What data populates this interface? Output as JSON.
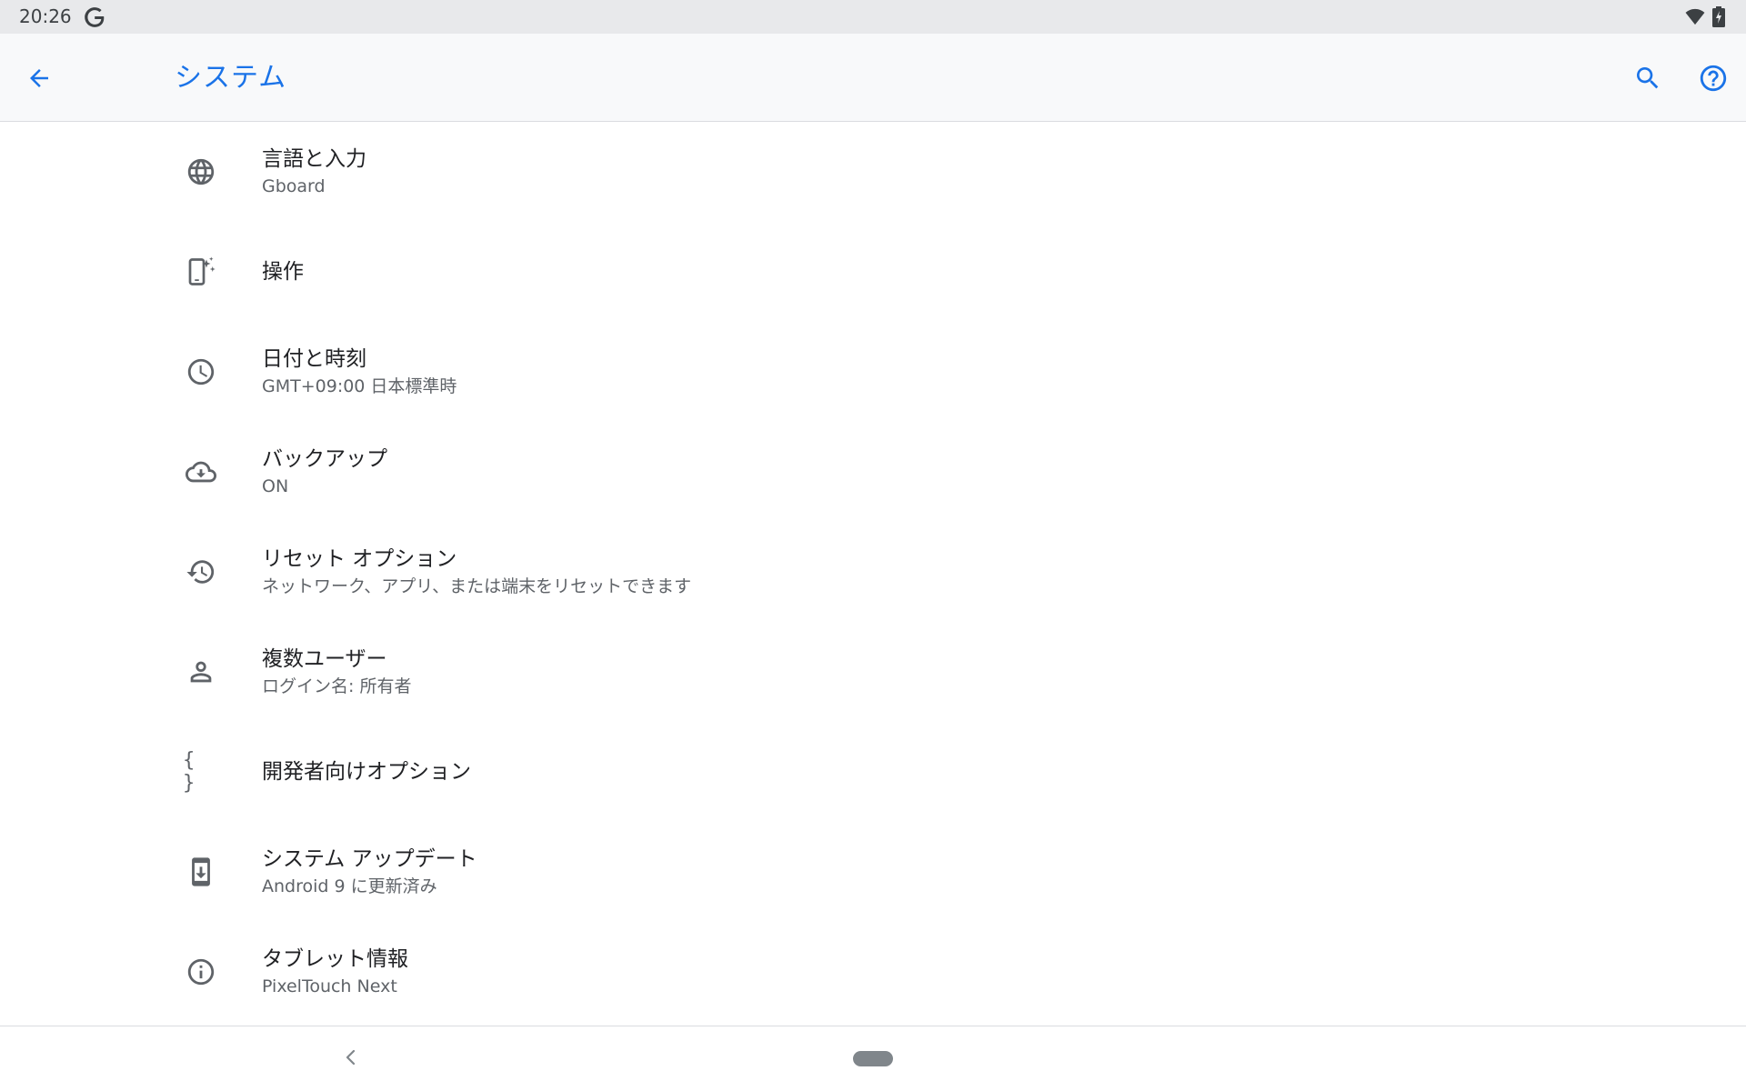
{
  "status_bar": {
    "time": "20:26",
    "icons": [
      "google-icon",
      "wifi-icon",
      "battery-charging-icon"
    ]
  },
  "app_bar": {
    "title": "システム",
    "actions": [
      "back-arrow-icon",
      "search-icon",
      "help-icon"
    ]
  },
  "settings": {
    "items": [
      {
        "icon": "globe-icon",
        "title": "言語と入力",
        "summary": "Gboard"
      },
      {
        "icon": "gesture-phone-icon",
        "title": "操作",
        "summary": ""
      },
      {
        "icon": "clock-icon",
        "title": "日付と時刻",
        "summary": "GMT+09:00 日本標準時"
      },
      {
        "icon": "cloud-backup-icon",
        "title": "バックアップ",
        "summary": "ON"
      },
      {
        "icon": "history-reset-icon",
        "title": "リセット オプション",
        "summary": "ネットワーク、アプリ、または端末をリセットできます"
      },
      {
        "icon": "person-icon",
        "title": "複数ユーザー",
        "summary": "ログイン名: 所有者"
      },
      {
        "icon": "braces-icon",
        "title": "開発者向けオプション",
        "summary": "",
        "glyph": "{ }"
      },
      {
        "icon": "system-update-icon",
        "title": "システム アップデート",
        "summary": "Android 9 に更新済み"
      },
      {
        "icon": "info-icon",
        "title": "タブレット情報",
        "summary": "PixelTouch Next"
      }
    ]
  },
  "colors": {
    "accent": "#1a73e8",
    "icon": "#5f6368",
    "status_bar_bg": "#e8e9eb",
    "app_bar_bg": "#f8f9fa"
  }
}
